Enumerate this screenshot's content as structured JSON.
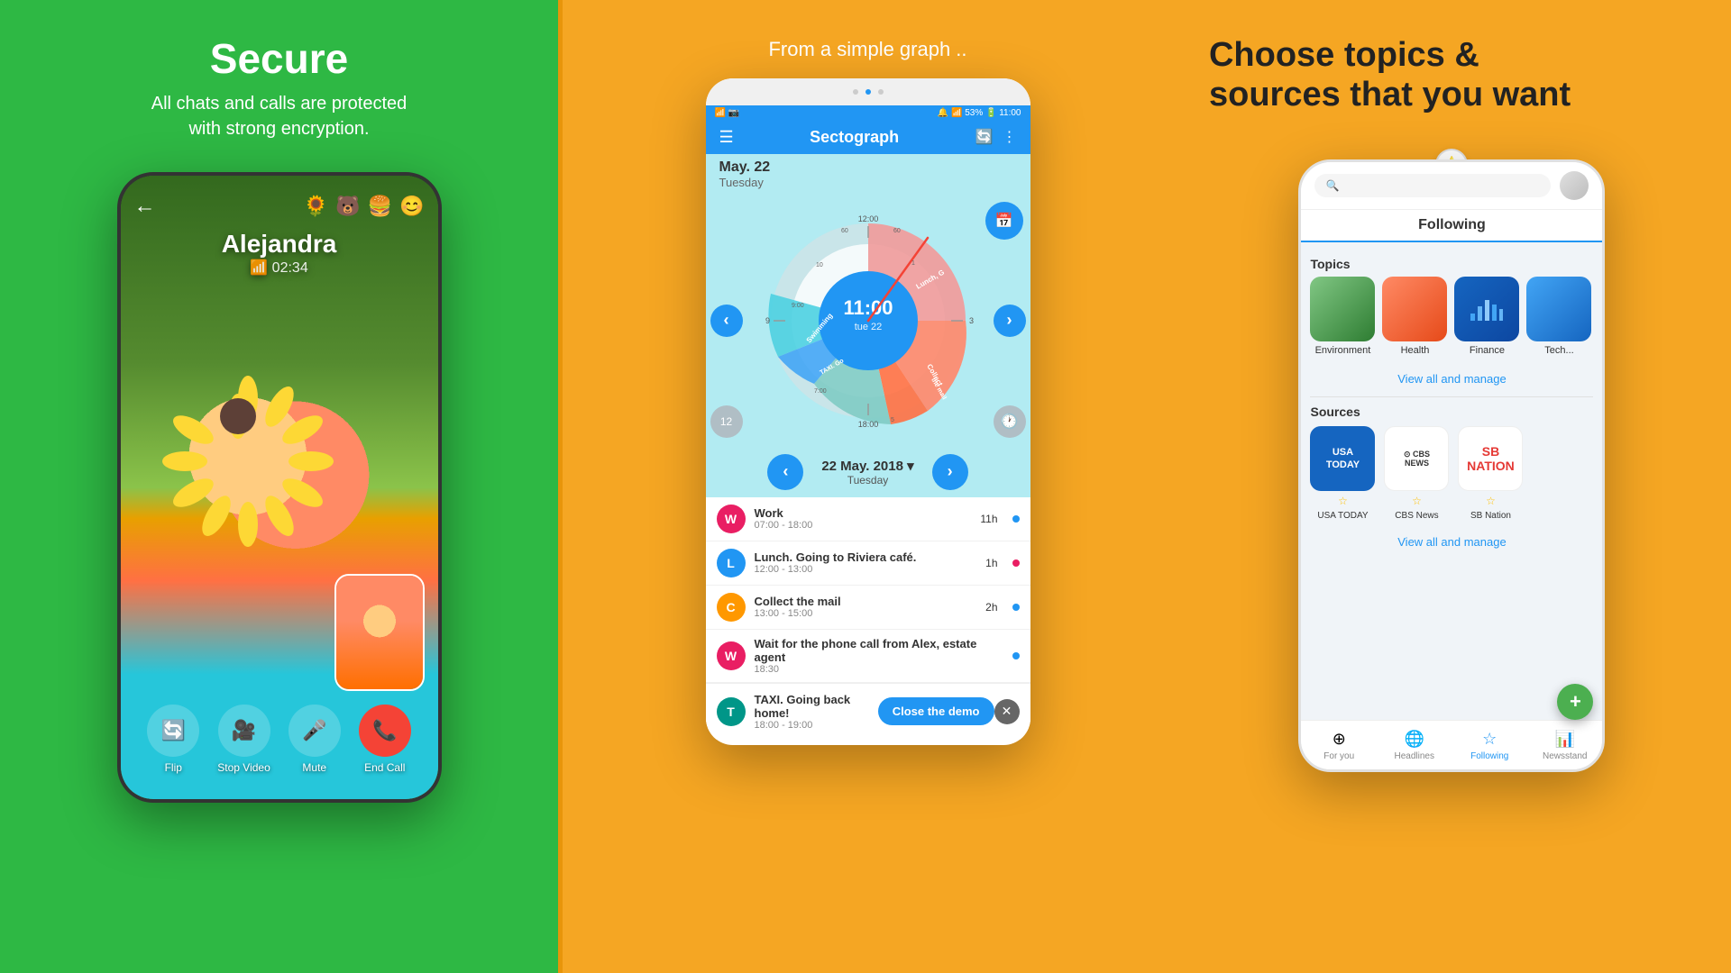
{
  "panels": {
    "left": {
      "heading": "Secure",
      "subheading": "All chats and calls are protected\nwith strong encryption.",
      "call": {
        "caller_name": "Alejandra",
        "duration": "02:34",
        "emojis": [
          "🌻",
          "🐻",
          "🍔",
          "😊"
        ],
        "controls": [
          "Flip",
          "Stop Video",
          "Mute",
          "End Call"
        ]
      }
    },
    "middle": {
      "heading_sub": "From a simple graph ..",
      "app_title": "Sectograph",
      "date_main": "May. 22",
      "date_day": "Tuesday",
      "date_full": "22 May. 2018 ▾",
      "date_day_full": "Tuesday",
      "events": [
        {
          "letter": "W",
          "color": "ev-pink",
          "name": "Work",
          "time": "07:00 - 18:00",
          "duration": "11h",
          "dot": "dot-blue"
        },
        {
          "letter": "L",
          "color": "ev-blue",
          "name": "Lunch. Going to Riviera café.",
          "time": "12:00 - 13:00",
          "duration": "1h",
          "dot": "dot-pink"
        },
        {
          "letter": "C",
          "color": "ev-orange",
          "name": "Collect the mail",
          "time": "13:00 - 15:00",
          "duration": "2h",
          "dot": "dot-blue"
        },
        {
          "letter": "W",
          "color": "ev-pink",
          "name": "Wait for the phone call from Alex, estate agent",
          "time": "18:30",
          "duration": "",
          "dot": "dot-blue"
        },
        {
          "letter": "T",
          "color": "ev-teal",
          "name": "TAXI. Going back home!",
          "time": "18:00 - 19:00",
          "duration": "",
          "dot": ""
        }
      ],
      "close_demo": "Close the demo"
    },
    "right": {
      "heading": "Choose topics &\nsources that you want",
      "following_tab": "Following",
      "topics_label": "Topics",
      "topics": [
        {
          "name": "Environment",
          "color_class": "topic-env"
        },
        {
          "name": "Health",
          "color_class": "topic-health"
        },
        {
          "name": "Finance",
          "color_class": "topic-finance"
        },
        {
          "name": "Tech",
          "color_class": "topic-tech"
        }
      ],
      "view_all_topics": "View all and manage",
      "sources_label": "Sources",
      "sources": [
        {
          "name": "USA TODAY",
          "logo_class": "source-usa",
          "logo_text": "USA\nTODAY"
        },
        {
          "name": "CBS News",
          "logo_class": "source-cbs",
          "logo_text": "⊙CBS\nNEWS"
        },
        {
          "name": "SB Nation",
          "logo_class": "source-sb",
          "logo_text": "SB\nNATION"
        }
      ],
      "view_all_sources": "View all and manage",
      "nav": [
        {
          "icon": "⊕",
          "label": "For you"
        },
        {
          "icon": "🌐",
          "label": "Headlines"
        },
        {
          "icon": "☆",
          "label": "Following",
          "active": true
        },
        {
          "icon": "📊",
          "label": "Newsstand"
        }
      ]
    }
  }
}
